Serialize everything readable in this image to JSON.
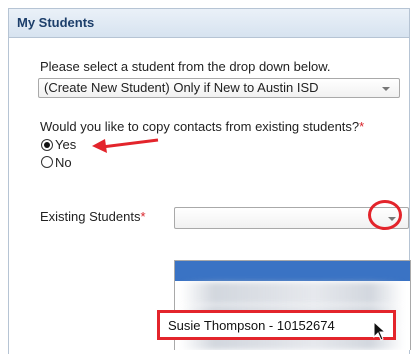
{
  "panel": {
    "title": "My Students"
  },
  "student_select": {
    "prompt": "Please select a student from the drop down below.",
    "value": "(Create New Student) Only if New to Austin ISD"
  },
  "copy_contacts": {
    "question": "Would you like to copy contacts from existing students?",
    "required_marker": "*",
    "options": [
      {
        "label": "Yes",
        "selected": true
      },
      {
        "label": "No",
        "selected": false
      }
    ]
  },
  "existing_students": {
    "label": "Existing Students",
    "required_marker": "*",
    "value": "",
    "highlighted_option": "Susie Thompson - 10152674"
  },
  "colors": {
    "annotation_red": "#e3242b",
    "selection_blue": "#3a73c4",
    "title_text": "#1c3e6a"
  }
}
